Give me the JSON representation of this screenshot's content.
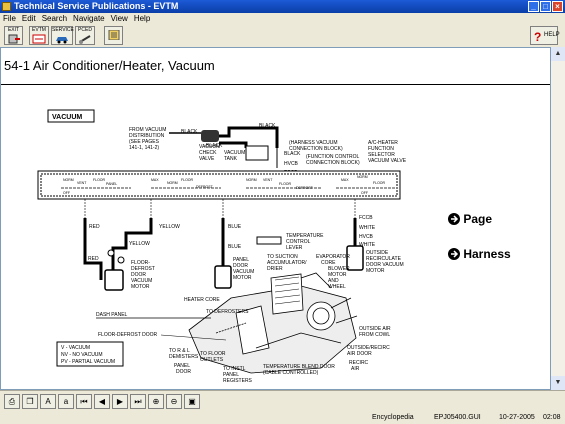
{
  "window": {
    "title": "Technical Service Publications - EVTM"
  },
  "menu": [
    "File",
    "Edit",
    "Search",
    "Navigate",
    "View",
    "Help"
  ],
  "toolbar": {
    "buttons": [
      "EXIT",
      "EVTM",
      "SERVICE",
      "PCED",
      ""
    ],
    "help": "HELP"
  },
  "page": {
    "title": "54-1 Air Conditioner/Heater, Vacuum"
  },
  "links": {
    "page": "Page",
    "harness": "Harness"
  },
  "diagram": {
    "vacuum_label": "VACUUM",
    "from_vacuum": [
      "FROM VACUUM",
      "DISTRIBUTION",
      "(SEE PAGES",
      "141-1, 141-2)"
    ],
    "black": "BLACK",
    "check_valve": [
      "VACUUM",
      "CHECK",
      "VALVE"
    ],
    "vacuum_tank": [
      "VACUUM",
      "TANK"
    ],
    "harness_block": [
      "(HARNESS VACUUM",
      "CONNECTION BLOCK)"
    ],
    "function_block": [
      "(FUNCTION CONTROL",
      "CONNECTION BLOCK)"
    ],
    "selector": [
      "A/C-HEATER",
      "FUNCTION",
      "SELECTOR",
      "VACUUM VALVE"
    ],
    "hvcb": "HVCB",
    "fccb": "FCCB",
    "red": "RED",
    "yellow": "YELLOW",
    "blue": "BLUE",
    "white": "WHITE",
    "floor_motor": [
      "FLOOR-",
      "DEFROST",
      "DOOR",
      "VACUUM",
      "MOTOR"
    ],
    "panel_motor": [
      "PANEL",
      "DOOR",
      "VACUUM",
      "MOTOR"
    ],
    "temp_lever": [
      "TEMPERATURE",
      "CONTROL",
      "LEVER"
    ],
    "suction": [
      "TO SUCTION",
      "ACCUMULATOR/",
      "DRIER"
    ],
    "evap": [
      "EVAPORATOR",
      "CORE"
    ],
    "blower": [
      "BLOWER",
      "MOTOR",
      "AND",
      "WHEEL"
    ],
    "recirc_motor": [
      "OUTSIDE",
      "RECIRCULATE",
      "DOOR VACUUM",
      "MOTOR"
    ],
    "heater_core": "HEATER CORE",
    "defrosters": "TO DEFROSTERS",
    "dash_panel": "DASH PANEL",
    "floor_door": "FLOOR-DEFROST DOOR",
    "demisters": [
      "TO R & L",
      "DEMISTERS"
    ],
    "floor_outlets": [
      "TO FLOOR",
      "OUTLETS"
    ],
    "panel_door": [
      "PANEL",
      "DOOR"
    ],
    "instl_registers": [
      "TO INSTL",
      "PANEL",
      "REGISTERS"
    ],
    "blend_door": [
      "TEMPERATURE BLEND DOOR",
      "(CABLE CONTROLLED)"
    ],
    "outside_air": [
      "OUTSIDE AIR",
      "FROM COWL"
    ],
    "recirc_door": [
      "OUTSIDE/RECIRC",
      "AIR DOOR"
    ],
    "recirc_air": [
      "RECIRC",
      "AIR"
    ],
    "legend": [
      "V - VACUUM",
      "NV - NO VACUUM",
      "PV - PARTIAL VACUUM"
    ],
    "switch_left": [
      "NORM",
      "VENT",
      "FLOOR",
      "PANEL",
      "OFF",
      "MAX"
    ],
    "switch_right": [
      "MAX",
      "NORM",
      "VENT",
      "FLOOR",
      "DEFROST",
      "OFF"
    ]
  },
  "status": {
    "encyclopedia": "Encyclopedia",
    "file": "EPJ05400.GUI",
    "date": "10-27-2005",
    "time": "02:08"
  }
}
